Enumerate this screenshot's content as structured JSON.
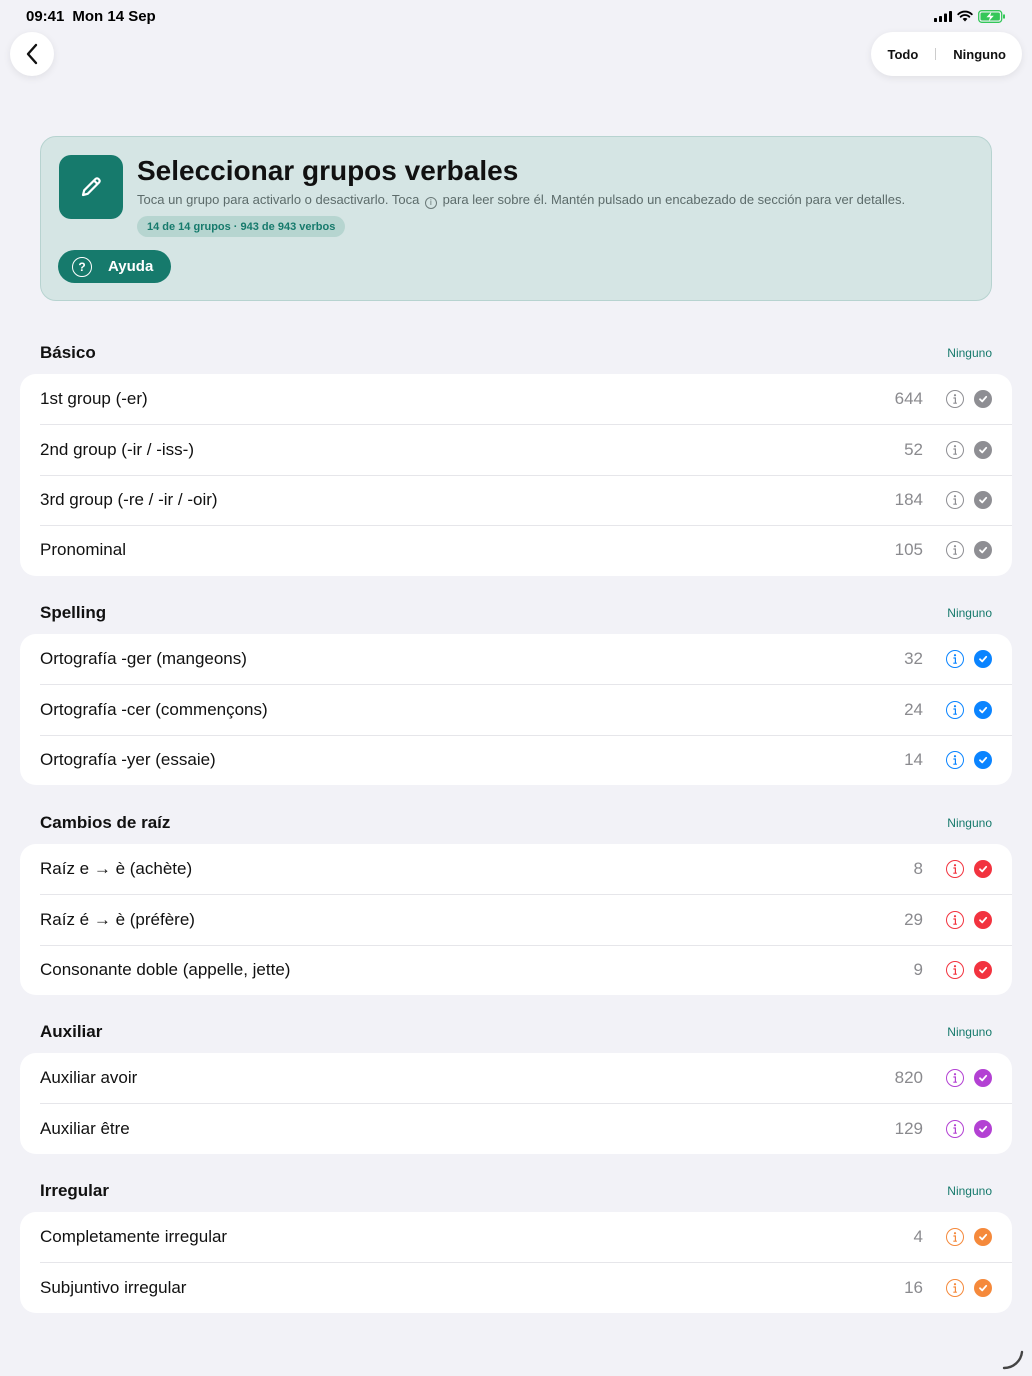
{
  "status_bar": {
    "time": "09:41",
    "date": "Mon 14 Sep"
  },
  "toolbar": {
    "all_label": "Todo",
    "none_label": "Ninguno"
  },
  "hero": {
    "title": "Seleccionar grupos verbales",
    "subtitle_before": "Toca un grupo para activarlo o desactivarlo. Toca",
    "subtitle_after": "para leer sobre él. Mantén pulsado un encabezado de sección para ver detalles.",
    "summary": "14 de 14 grupos · 943 de 943 verbos",
    "help_label": "Ayuda",
    "accent": "#167a6c"
  },
  "sections": [
    {
      "title": "Básico",
      "none_label": "Ninguno",
      "color": "#8e8e93",
      "items": [
        {
          "label": "1st group (-er)",
          "count": "644"
        },
        {
          "label": "2nd group (-ir / -iss-)",
          "count": "52"
        },
        {
          "label": "3rd group (-re / -ir / -oir)",
          "count": "184"
        },
        {
          "label": "Pronominal",
          "count": "105"
        }
      ]
    },
    {
      "title": "Spelling",
      "none_label": "Ninguno",
      "color": "#0a84ff",
      "items": [
        {
          "label": "Ortografía -ger (mangeons)",
          "count": "32"
        },
        {
          "label": "Ortografía -cer (commençons)",
          "count": "24"
        },
        {
          "label": "Ortografía -yer (essaie)",
          "count": "14"
        }
      ]
    },
    {
      "title": "Cambios de raíz",
      "none_label": "Ninguno",
      "color": "#f2333f",
      "items": [
        {
          "label": "Raíz e → è (achète)",
          "count": "8"
        },
        {
          "label": "Raíz é → è (préfère)",
          "count": "29"
        },
        {
          "label": "Consonante doble (appelle, jette)",
          "count": "9"
        }
      ]
    },
    {
      "title": "Auxiliar",
      "none_label": "Ninguno",
      "color": "#b341d3",
      "items": [
        {
          "label": "Auxiliar avoir",
          "count": "820"
        },
        {
          "label": "Auxiliar être",
          "count": "129"
        }
      ]
    },
    {
      "title": "Irregular",
      "none_label": "Ninguno",
      "color": "#f5893b",
      "items": [
        {
          "label": "Completamente irregular",
          "count": "4"
        },
        {
          "label": "Subjuntivo irregular",
          "count": "16"
        }
      ]
    }
  ]
}
